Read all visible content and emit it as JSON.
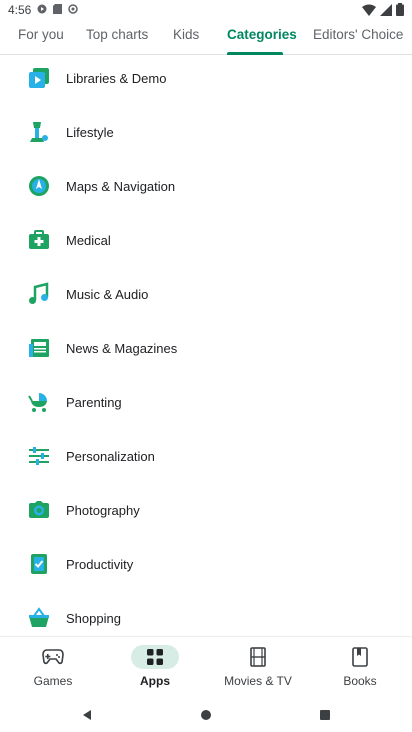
{
  "status": {
    "time": "4:56"
  },
  "tabs": [
    {
      "label": "For you",
      "active": false
    },
    {
      "label": "Top charts",
      "active": false
    },
    {
      "label": "Kids",
      "active": false
    },
    {
      "label": "Categories",
      "active": true
    },
    {
      "label": "Editors' Choice",
      "active": false
    }
  ],
  "categories": [
    {
      "label": "Libraries & Demo",
      "icon": "libraries-icon"
    },
    {
      "label": "Lifestyle",
      "icon": "lifestyle-icon"
    },
    {
      "label": "Maps & Navigation",
      "icon": "maps-icon"
    },
    {
      "label": "Medical",
      "icon": "medical-icon"
    },
    {
      "label": "Music & Audio",
      "icon": "music-icon"
    },
    {
      "label": "News & Magazines",
      "icon": "news-icon"
    },
    {
      "label": "Parenting",
      "icon": "stroller-icon"
    },
    {
      "label": "Personalization",
      "icon": "sliders-icon"
    },
    {
      "label": "Photography",
      "icon": "camera-icon"
    },
    {
      "label": "Productivity",
      "icon": "checklist-icon"
    },
    {
      "label": "Shopping",
      "icon": "basket-icon"
    }
  ],
  "bottom_nav": [
    {
      "label": "Games",
      "icon": "gamepad-icon",
      "active": false
    },
    {
      "label": "Apps",
      "icon": "apps-grid-icon",
      "active": true
    },
    {
      "label": "Movies & TV",
      "icon": "film-icon",
      "active": false
    },
    {
      "label": "Books",
      "icon": "book-icon",
      "active": false
    }
  ],
  "colors": {
    "accent": "#01875f",
    "nav_active_bg": "#d6ece4"
  }
}
